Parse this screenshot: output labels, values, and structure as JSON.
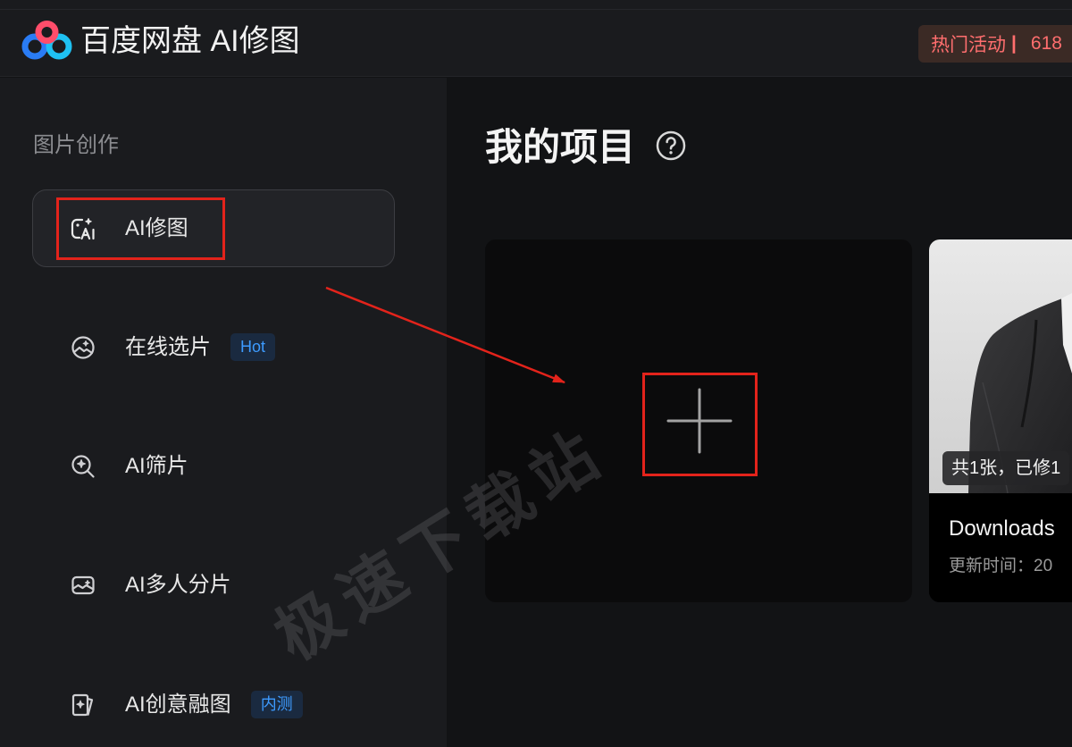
{
  "header": {
    "app_title": "百度网盘 AI修图",
    "logo_icon": "baidu-netdisk-logo",
    "promo": {
      "label": "热门活动",
      "separator": "|",
      "value": "618"
    }
  },
  "sidebar": {
    "section_title": "图片创作",
    "items": [
      {
        "label": "AI修图",
        "icon": "ai-retouch-icon",
        "active": true
      },
      {
        "label": "在线选片",
        "icon": "online-photo-select-icon",
        "active": false,
        "badge": "Hot"
      },
      {
        "label": "AI筛片",
        "icon": "ai-photo-filter-icon",
        "active": false
      },
      {
        "label": "AI多人分片",
        "icon": "ai-multi-person-split-icon",
        "active": false
      },
      {
        "label": "AI创意融图",
        "icon": "ai-creative-blend-icon",
        "active": false,
        "badge": "内测"
      }
    ]
  },
  "main": {
    "title": "我的项目",
    "help_icon": "question-circle-icon",
    "new_project_icon": "plus-icon",
    "projects": [
      {
        "photo_caption": "共1张，已修1",
        "name": "Downloads",
        "updated": "更新时间：20"
      }
    ]
  },
  "watermark": "极速下载站",
  "theme": {
    "--bg-header": "#1a1b1e",
    "--bg-sidebar": "#1a1b1e",
    "--bg-main": "#121315",
    "--bg-card": "#0b0b0c",
    "--badge-bg": "#1a2a40",
    "--badge-text": "#3d9bff",
    "--promo-bg": "#3b2a25",
    "--promo-text": "#ff6e6e",
    "--annot": "#e3231b"
  }
}
